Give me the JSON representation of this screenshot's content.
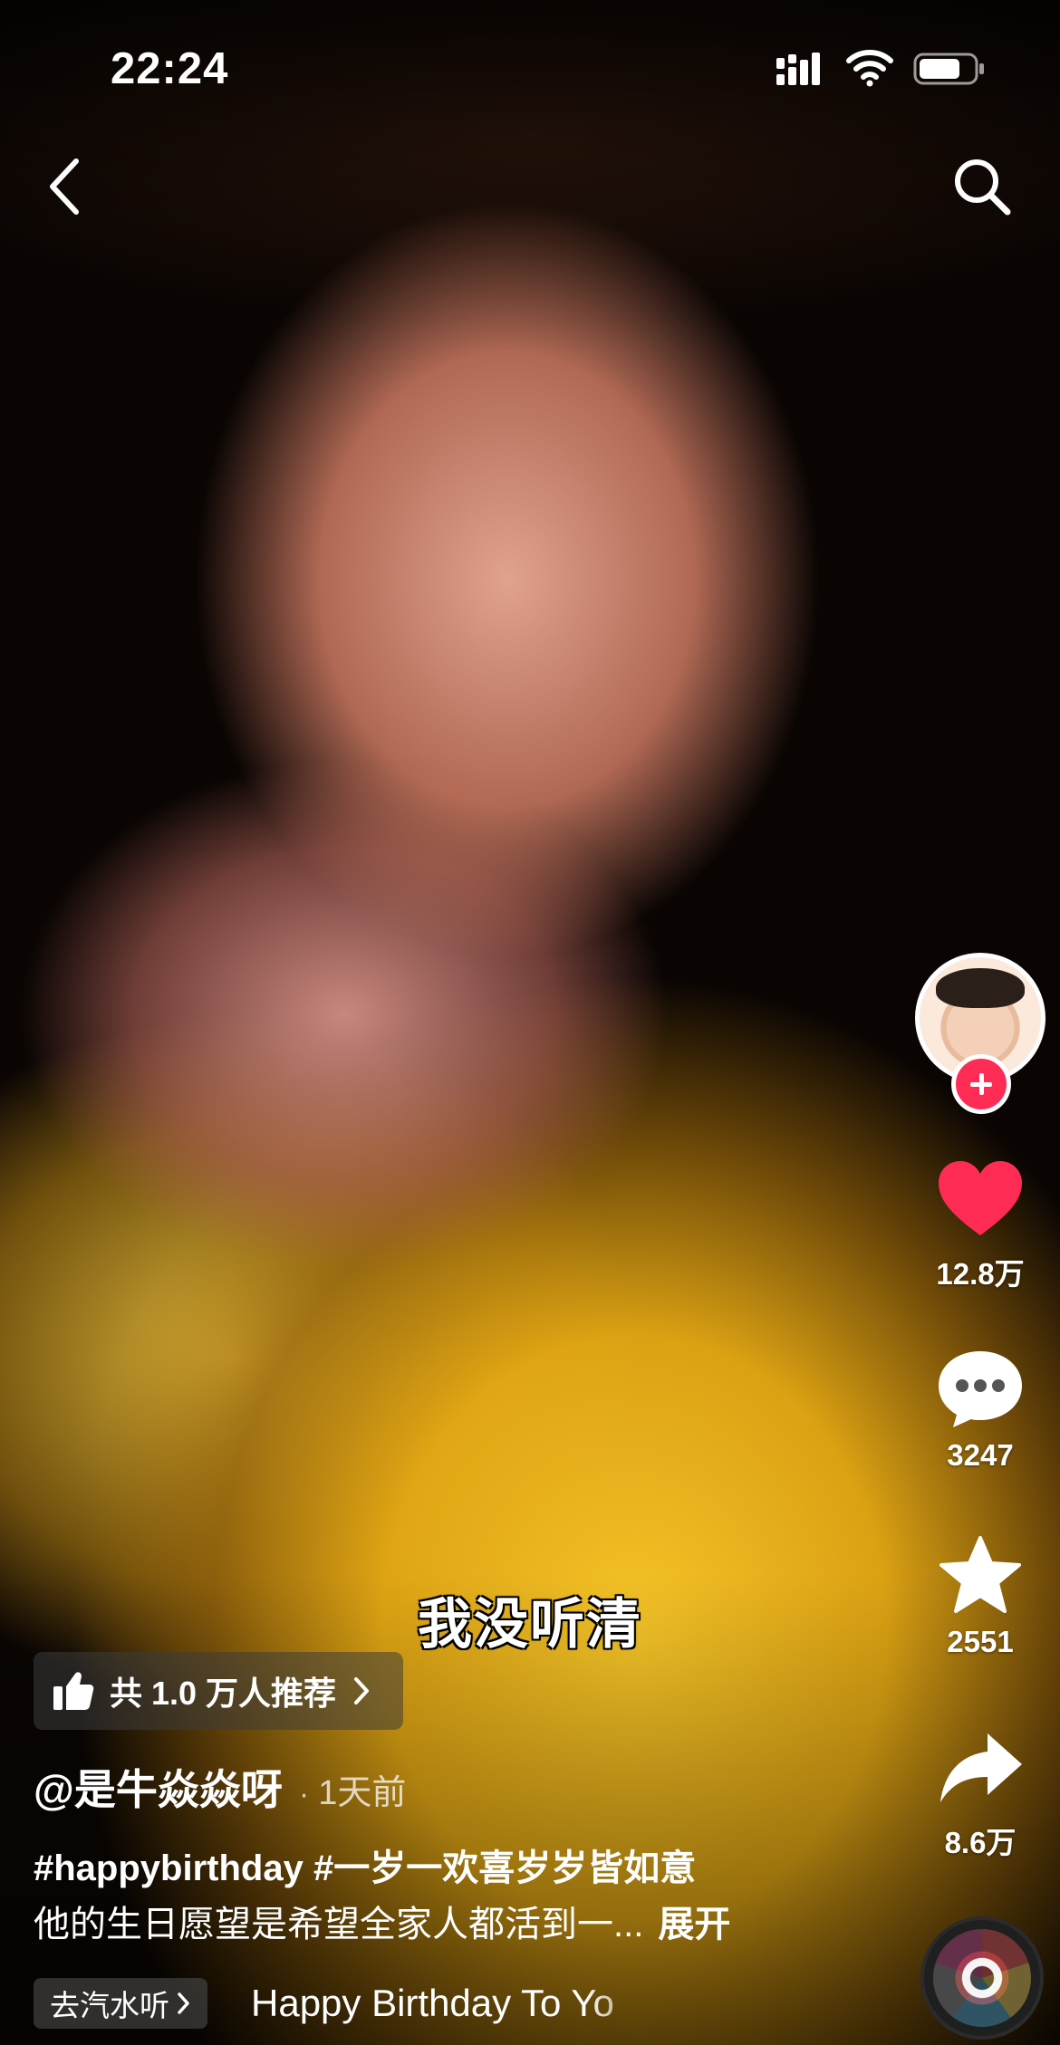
{
  "status_bar": {
    "time": "22:24",
    "battery_level": 0.75
  },
  "nav": {
    "back_icon": "chevron-left-icon",
    "search_icon": "search-icon"
  },
  "video": {
    "subtitle": "我没听清"
  },
  "actions": {
    "like_count": "12.8万",
    "comment_count": "3247",
    "favorite_count": "2551",
    "share_count": "8.6万",
    "like_color": "#fe2c55",
    "follow_color": "#fe2c55"
  },
  "recommend": {
    "label": "共 1.0 万人推荐"
  },
  "post": {
    "author": "@是牛焱焱呀",
    "time_ago": "1天前",
    "hashtags": "#happybirthday #一岁一欢喜岁岁皆如意",
    "caption": "他的生日愿望是希望全家人都活到一...",
    "expand_label": "展开"
  },
  "music": {
    "tag_label": "去汽水听",
    "title": "Happy Birthday To Yo"
  }
}
